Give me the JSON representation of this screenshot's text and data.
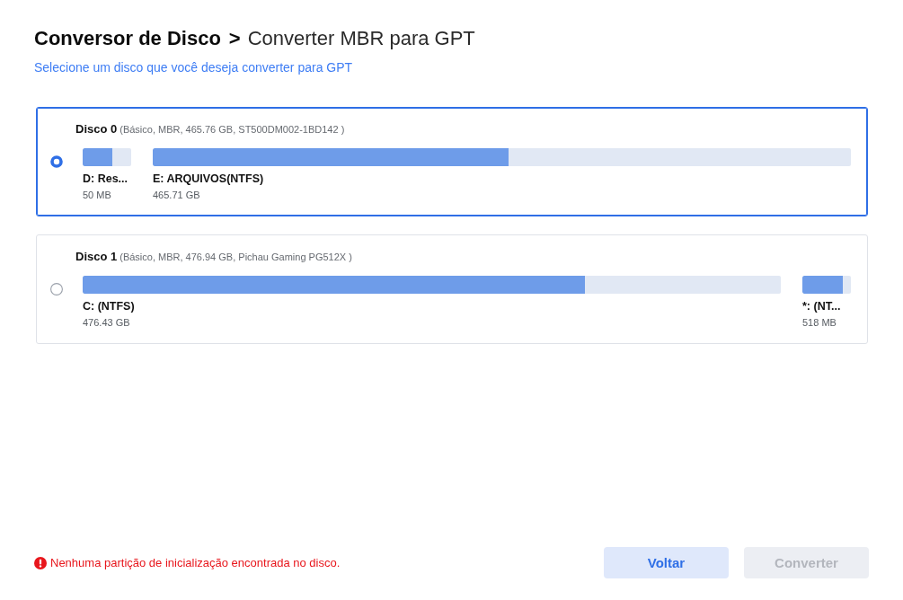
{
  "header": {
    "section": "Conversor de Disco",
    "separator": ">",
    "page": "Converter MBR para GPT",
    "subtitle": "Selecione um disco que você deseja converter para GPT"
  },
  "disks": [
    {
      "name": "Disco 0",
      "details": "(Básico, MBR, 465.76 GB, ST500DM002-1BD142 )",
      "selected": true,
      "partitions": [
        {
          "label": "D: Res...",
          "size": "50 MB",
          "kind": "small",
          "level": 0.61
        },
        {
          "label": "E: ARQUIVOS(NTFS)",
          "size": "465.71 GB",
          "kind": "large",
          "level": 0.51
        }
      ]
    },
    {
      "name": "Disco 1",
      "details": "(Básico, MBR, 476.94 GB, Pichau Gaming PG512X )",
      "selected": false,
      "partitions": [
        {
          "label": "C: (NTFS)",
          "size": "476.43 GB",
          "kind": "large",
          "level": 0.72
        },
        {
          "label": "*: (NT...",
          "size": "518 MB",
          "kind": "small",
          "level": 0.83
        }
      ]
    }
  ],
  "error": {
    "message": "Nenhuma partição de inicialização encontrada no disco."
  },
  "buttons": [
    {
      "label": "Voltar",
      "disabled": false
    },
    {
      "label": "Converter",
      "disabled": true
    }
  ]
}
